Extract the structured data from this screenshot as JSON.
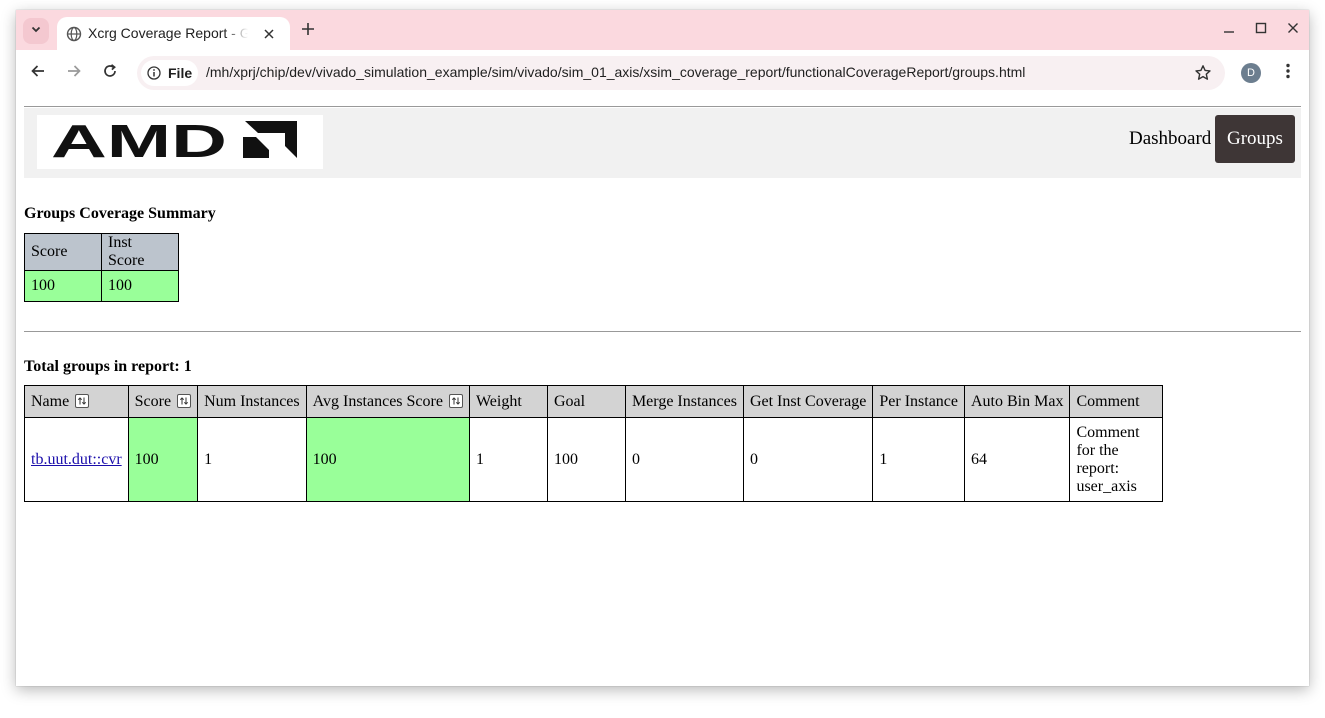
{
  "browser": {
    "tab_title": "Xcrg Coverage Report - Groups",
    "site_chip_label": "File",
    "url": "/mh/xprj/chip/dev/vivado_simulation_example/sim/vivado/sim_01_axis/xsim_coverage_report/functionalCoverageReport/groups.html",
    "profile_initial": "D",
    "colors": {
      "tabstrip": "#fbd9df",
      "omnibox": "#f8f0f2"
    }
  },
  "nav": {
    "logo_text": "AMD",
    "links": [
      {
        "label": "Dashboard",
        "active": false
      },
      {
        "label": "Groups",
        "active": true
      }
    ]
  },
  "summary": {
    "title": "Groups Coverage Summary",
    "headers": [
      "Score",
      "Inst Score"
    ],
    "values": [
      "100",
      "100"
    ]
  },
  "groups": {
    "total_label": "Total groups in report: 1",
    "headers": [
      "Name",
      "Score",
      "Num Instances",
      "Avg Instances Score",
      "Weight",
      "Goal",
      "Merge Instances",
      "Get Inst Coverage",
      "Per Instance",
      "Auto Bin Max",
      "Comment"
    ],
    "rows": [
      {
        "name": "tb.uut.dut::cvr",
        "score": "100",
        "num_instances": "1",
        "avg_instances_score": "100",
        "weight": "1",
        "goal": "100",
        "merge_instances": "0",
        "get_inst_coverage": "0",
        "per_instance": "1",
        "auto_bin_max": "64",
        "comment": "Comment for the report: user_axis"
      }
    ]
  },
  "colors": {
    "pass_green": "#99ff99",
    "header_grey": "#d3d3d3",
    "summary_header": "#bcc4cd",
    "nav_active": "#3e3636"
  }
}
